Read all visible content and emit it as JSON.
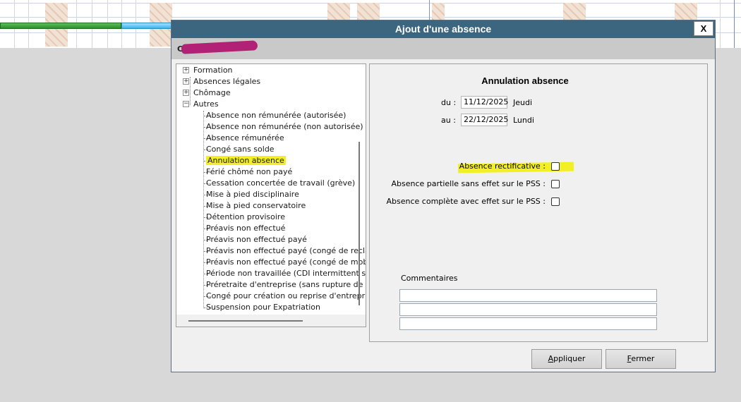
{
  "dialog": {
    "title": "Ajout d'une absence",
    "close_label": "X",
    "employee_name": "C"
  },
  "tree": {
    "parents": [
      {
        "label": "Formation",
        "toggle": "+"
      },
      {
        "label": "Absences légales",
        "toggle": "+"
      },
      {
        "label": "Chômage",
        "toggle": "+"
      },
      {
        "label": "Autres",
        "toggle": "−"
      }
    ],
    "children": [
      "Absence non rémunérée (autorisée)",
      "Absence non rémunérée (non autorisée)",
      "Absence rémunérée",
      "Congé sans solde",
      "Annulation absence",
      "Férié chômé non payé",
      "Cessation concertée de travail (grève)",
      "Mise à pied disciplinaire",
      "Mise à pied conservatoire",
      "Détention provisoire",
      "Préavis non effectué",
      "Préavis non effectué payé",
      "Préavis non effectué payé (congé de reclas",
      "Préavis non effectué payé (congé de mobili",
      "Période non travaillée (CDI intermittent san",
      "Préretraite d'entreprise (sans rupture de co",
      "Congé pour création ou reprise d'entreprise",
      "Suspension pour Expatriation"
    ],
    "selected": "Annulation absence"
  },
  "form": {
    "title": "Annulation absence",
    "du_label": "du :",
    "du_value": "11/12/2025",
    "du_day": "Jeudi",
    "au_label": "au :",
    "au_value": "22/12/2025",
    "au_day": "Lundi",
    "checkboxes": [
      {
        "label": "Absence rectificative :",
        "checked": false
      },
      {
        "label": "Absence partielle sans effet sur le PSS :",
        "checked": false
      },
      {
        "label": "Absence complète avec effet sur le PSS :",
        "checked": false
      }
    ],
    "comments_label": "Commentaires"
  },
  "buttons": {
    "apply_first": "A",
    "apply_rest": "ppliquer",
    "close_first": "F",
    "close_rest": "ermer"
  },
  "colors": {
    "titlebar": "#3c6680",
    "highlight": "#f3ef25",
    "scribble": "#b0126e"
  }
}
